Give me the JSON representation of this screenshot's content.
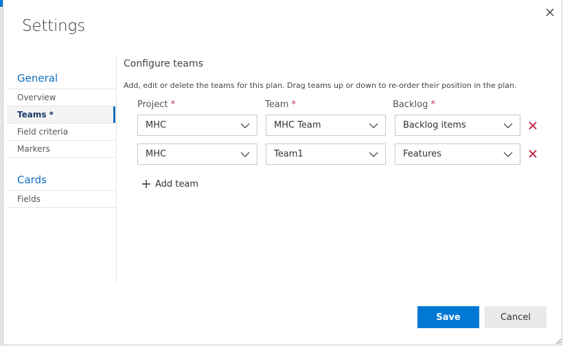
{
  "dialog": {
    "title": "Settings",
    "close_icon": "close-icon"
  },
  "nav": {
    "sections": [
      {
        "title": "General",
        "items": [
          {
            "label": "Overview",
            "selected": false
          },
          {
            "label": "Teams *",
            "selected": true
          },
          {
            "label": "Field criteria",
            "selected": false
          },
          {
            "label": "Markers",
            "selected": false
          }
        ]
      },
      {
        "title": "Cards",
        "items": [
          {
            "label": "Fields",
            "selected": false
          }
        ]
      }
    ]
  },
  "main": {
    "heading": "Configure teams",
    "description": "Add, edit or delete the teams for this plan. Drag teams up or down to re-order their position in the plan.",
    "columns": {
      "project": "Project",
      "team": "Team",
      "backlog": "Backlog",
      "required_marker": "*"
    },
    "rows": [
      {
        "project": "MHC",
        "team": "MHC Team",
        "backlog": "Backlog items"
      },
      {
        "project": "MHC",
        "team": "Team1",
        "backlog": "Features"
      }
    ],
    "add_team_label": "Add team"
  },
  "footer": {
    "save_label": "Save",
    "cancel_label": "Cancel"
  },
  "colors": {
    "accent": "#0078d4",
    "nav_link": "#106ebe",
    "delete": "#c4314b",
    "required": "#c4314b"
  },
  "icons": {
    "dropdown": "chevron-down-icon",
    "delete": "delete-x-icon",
    "add": "plus-icon",
    "resize": "resize-grip-icon"
  }
}
